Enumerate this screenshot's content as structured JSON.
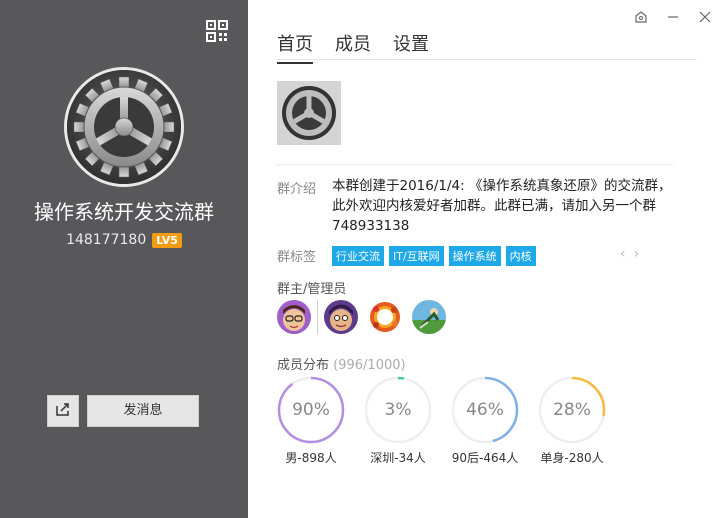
{
  "group": {
    "name": "操作系统开发交流群",
    "id": "148177180",
    "level": "LV5"
  },
  "left_actions": {
    "send_message_label": "发消息"
  },
  "tabs": [
    {
      "label": "首页",
      "active": true
    },
    {
      "label": "成员",
      "active": false
    },
    {
      "label": "设置",
      "active": false
    }
  ],
  "intro": {
    "label": "群介绍",
    "text": "本群创建于2016/1/4: 《操作系统真象还原》的交流群，此外欢迎内核爱好者加群。此群已满，请加入另一个群748933138"
  },
  "tags_section": {
    "label": "群标签",
    "tags": [
      "行业交流",
      "IT/互联网",
      "操作系统",
      "内核"
    ]
  },
  "admins_section": {
    "label": "群主/管理员"
  },
  "distribution": {
    "label": "成员分布",
    "count": "(996/1000)",
    "stats": [
      {
        "percent_label": "90%",
        "value": 0.9,
        "label": "男-898人",
        "color": "#b48ee0"
      },
      {
        "percent_label": "3%",
        "value": 0.03,
        "label": "深圳-34人",
        "color": "#4cc9a8"
      },
      {
        "percent_label": "46%",
        "value": 0.46,
        "label": "90后-464人",
        "color": "#7fb0e6"
      },
      {
        "percent_label": "28%",
        "value": 0.28,
        "label": "单身-280人",
        "color": "#f5b942"
      }
    ]
  },
  "colors": {
    "left_panel": "#58585a",
    "tag_bg": "#1ea8e8",
    "level_badge": "#f39c12"
  }
}
